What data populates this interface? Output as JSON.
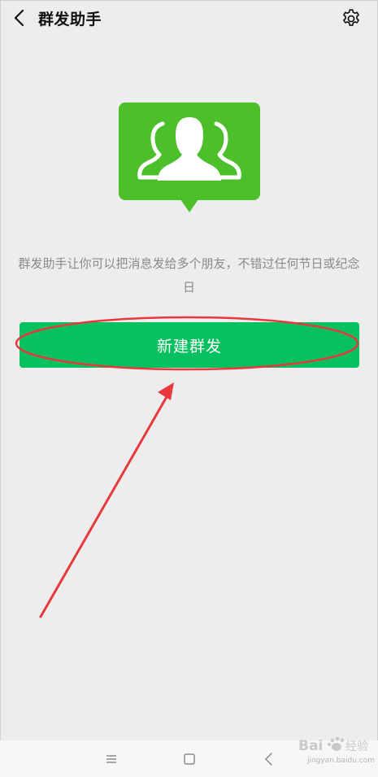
{
  "header": {
    "title": "群发助手"
  },
  "main": {
    "description": "群发助手让你可以把消息发给多个朋友，不错过任何节日或纪念日",
    "new_broadcast_label": "新建群发"
  },
  "watermark": {
    "text": "jingyan.baidu.com",
    "logo": "Bai经验"
  },
  "colors": {
    "accent_green": "#07c160",
    "icon_green": "#4cbf2a",
    "annotation_red": "#e8383d",
    "background": "#ededed"
  },
  "icons": [
    "back-chevron-icon",
    "gear-icon",
    "group-chat-icon",
    "menu-icon",
    "home-icon",
    "back-icon"
  ]
}
